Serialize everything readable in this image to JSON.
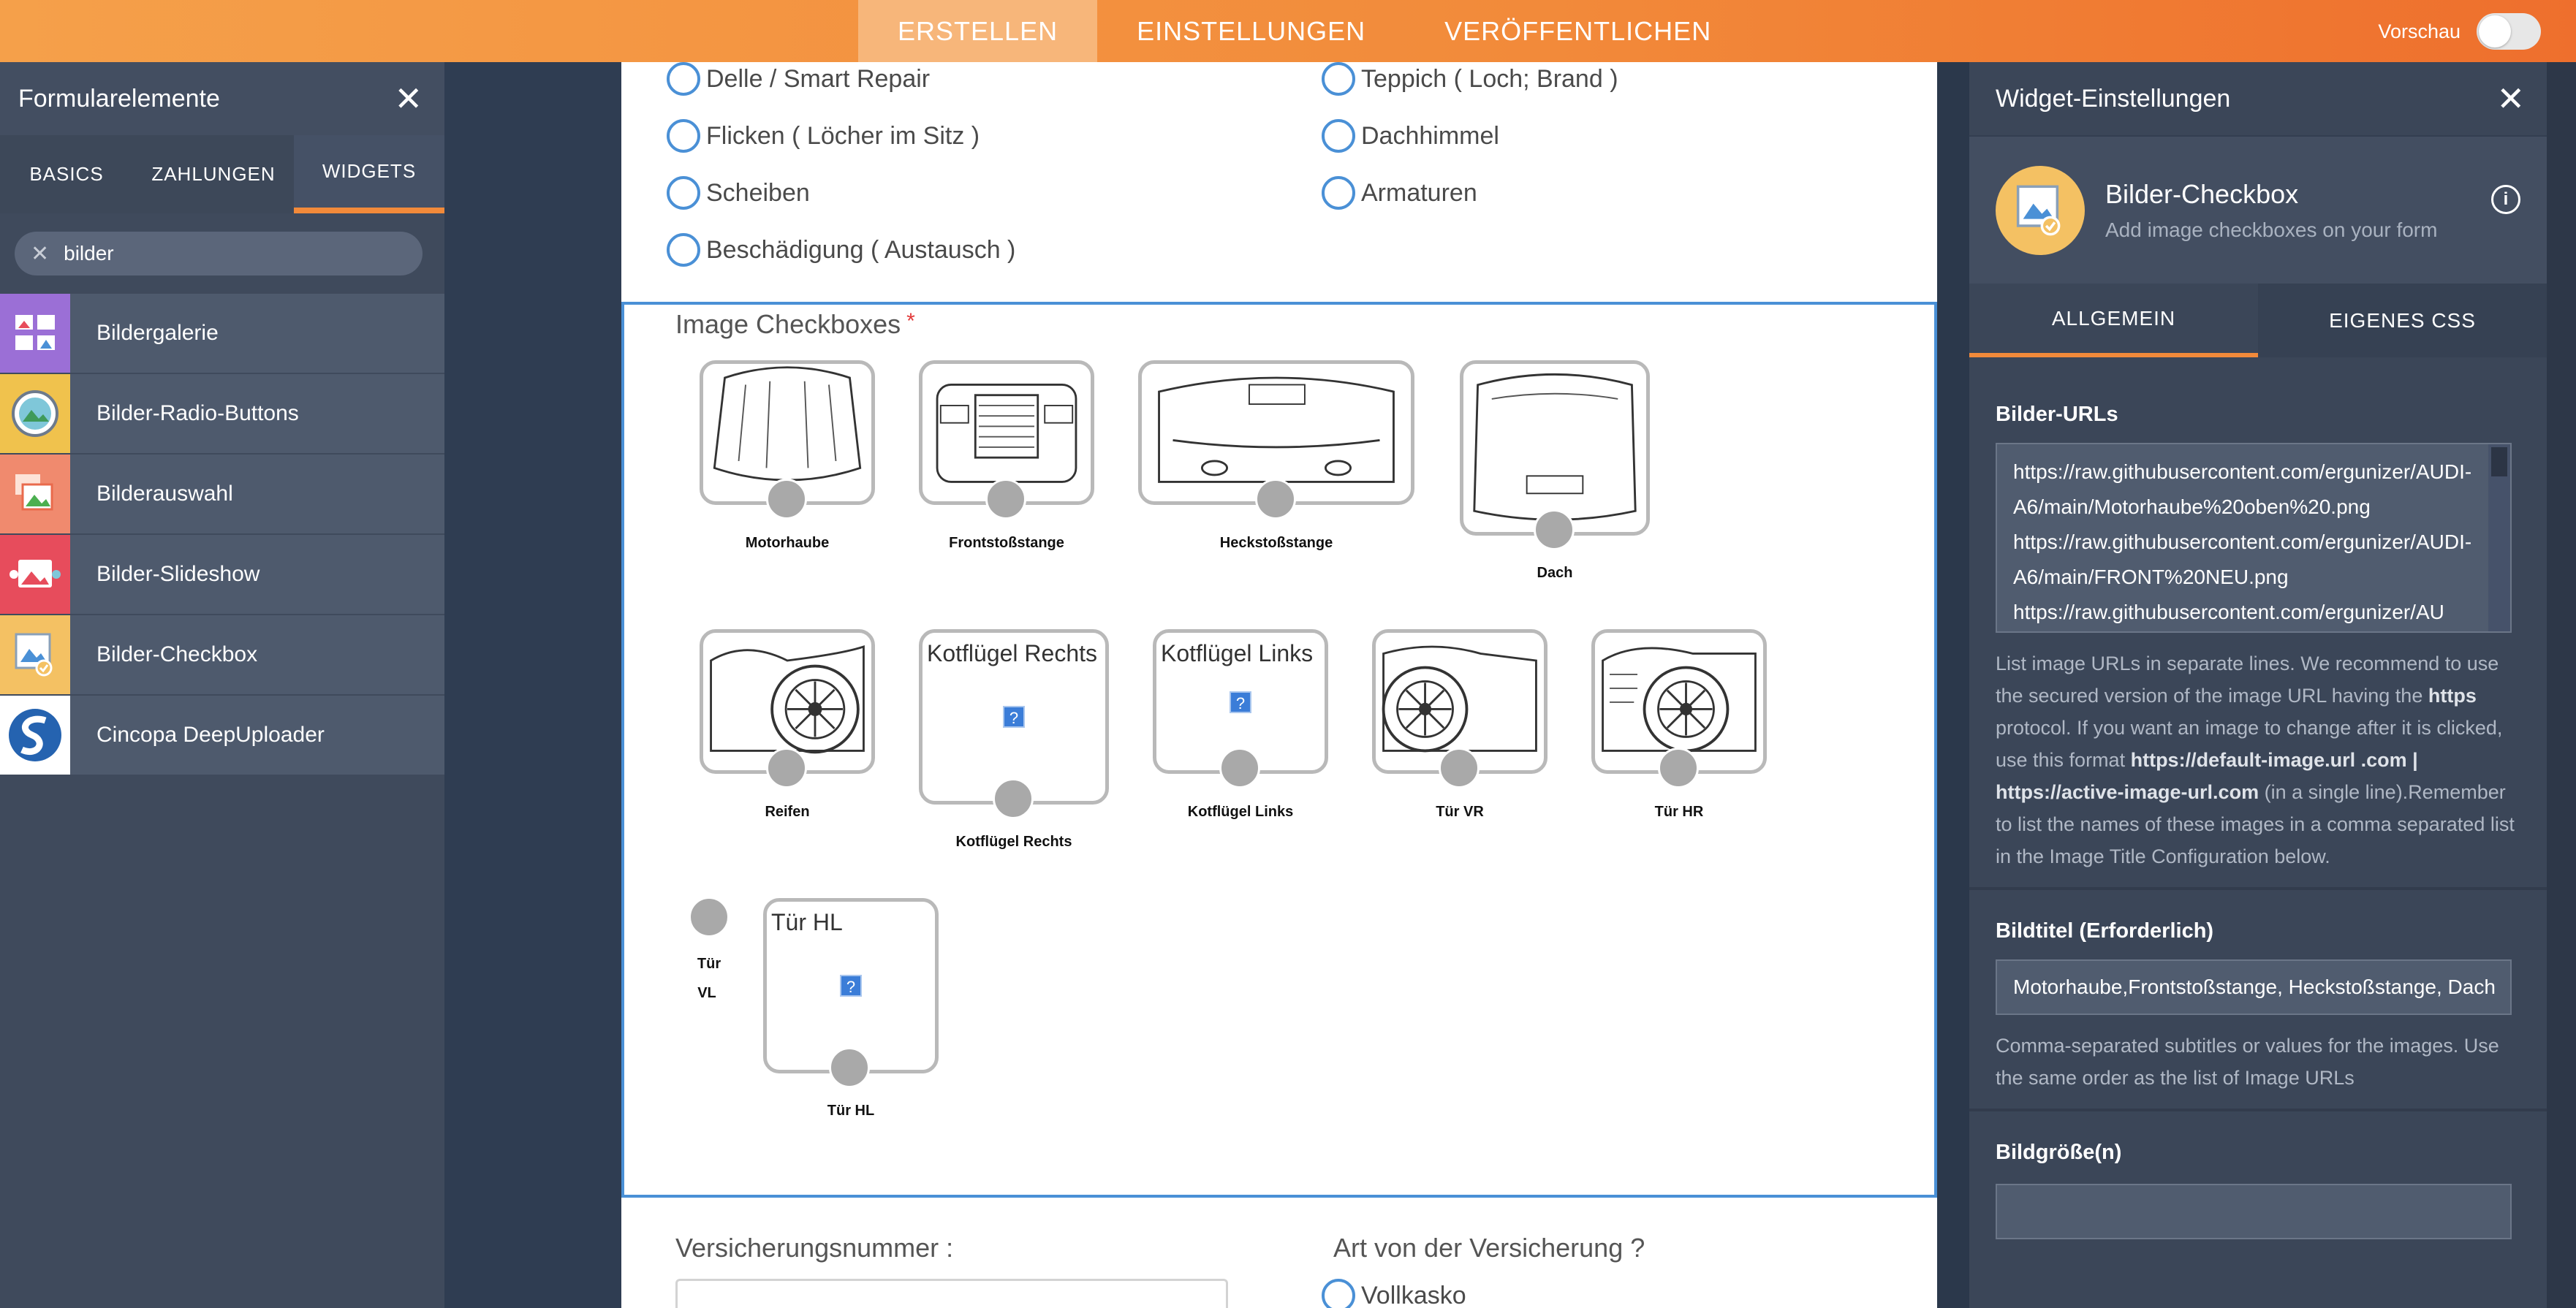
{
  "topbar": {
    "tabs": [
      "ERSTELLEN",
      "EINSTELLUNGEN",
      "VERÖFFENTLICHEN"
    ],
    "active_tab": "ERSTELLEN",
    "preview_label": "Vorschau",
    "preview_on": false,
    "brand_color": "#f28a3a"
  },
  "left_panel": {
    "title": "Formularelemente",
    "tabs": [
      "BASICS",
      "ZAHLUNGEN",
      "WIDGETS"
    ],
    "active_tab": "WIDGETS",
    "search_value": "bilder",
    "widgets": [
      {
        "label": "Bildergalerie",
        "icon": "gallery-icon",
        "color": "#9b6fd6"
      },
      {
        "label": "Bilder-Radio-Buttons",
        "icon": "image-radio-icon",
        "color": "#f0c24d"
      },
      {
        "label": "Bilderauswahl",
        "icon": "image-picker-icon",
        "color": "#f08a6e"
      },
      {
        "label": "Bilder-Slideshow",
        "icon": "slideshow-icon",
        "color": "#e74c5c"
      },
      {
        "label": "Bilder-Checkbox",
        "icon": "image-checkbox-icon",
        "color": "#f4c163"
      },
      {
        "label": "Cincopa DeepUploader",
        "icon": "cincopa-icon",
        "color": "#ffffff"
      }
    ]
  },
  "form": {
    "radio_options": [
      {
        "label": "Delle / Smart Repair"
      },
      {
        "label": "Teppich ( Loch; Brand )"
      },
      {
        "label": "Flicken ( Löcher im Sitz )"
      },
      {
        "label": "Dachhimmel"
      },
      {
        "label": "Scheiben"
      },
      {
        "label": "Armaturen"
      },
      {
        "label": "Beschädigung ( Austausch )"
      }
    ],
    "image_checkboxes": {
      "title": "Image Checkboxes",
      "required_mark": "*",
      "items": [
        {
          "caption": "Motorhaube"
        },
        {
          "caption": "Frontstoßstange"
        },
        {
          "caption": "Heckstoßstange"
        },
        {
          "caption": "Dach"
        },
        {
          "caption": "Reifen"
        },
        {
          "caption": "Kotflügel Rechts",
          "broken_title": "Kotflügel Rechts"
        },
        {
          "caption": "Kotflügel Links",
          "broken_title": "Kotflügel Links"
        },
        {
          "caption": "Tür VR"
        },
        {
          "caption": "Tür HR"
        },
        {
          "caption": "Tür VL",
          "caption_line1": "Tür",
          "caption_line2": "VL"
        },
        {
          "caption": "Tür HL",
          "broken_title": "Tür HL"
        }
      ],
      "broken_image_glyph": "?"
    },
    "insurance_number_label": "Versicherungsnummer :",
    "insurance_type_label": "Art von der Versicherung ?",
    "insurance_type_option": "Vollkasko"
  },
  "right_panel": {
    "title": "Widget-Einstellungen",
    "widget_name": "Bilder-Checkbox",
    "widget_desc": "Add image checkboxes on your form",
    "info_glyph": "i",
    "tabs": [
      "ALLGEMEIN",
      "EIGENES CSS"
    ],
    "active_tab": "ALLGEMEIN",
    "image_urls_label": "Bilder-URLs",
    "image_urls_value": "https://raw.githubusercontent.com/ergunizer/AUDI-A6/main/Motorhaube%20oben%20.png\nhttps://raw.githubusercontent.com/ergunizer/AUDI-A6/main/FRONT%20NEU.png\nhttps://raw.githubusercontent.com/ergunizer/AU",
    "image_urls_help_1": "List image URLs in separate lines. We recommend to use the secured version of the image URL having the",
    "image_urls_help_https": "https",
    "image_urls_help_2": "protocol. If you want an image to change after it is clicked, use this format",
    "image_urls_help_format": "https://default-image.url .com | https://active-image-url.com",
    "image_urls_help_3": "(in a single line).Remember to list the names of these images in a comma separated list in the Image Title Configuration below.",
    "title_label": "Bildtitel (Erforderlich)",
    "title_value": "Motorhaube,Frontstoßstange, Heckstoßstange, Dach",
    "title_help": "Comma-separated subtitles or values for the images. Use the same order as the list of Image URLs",
    "size_label": "Bildgröße(n)"
  }
}
